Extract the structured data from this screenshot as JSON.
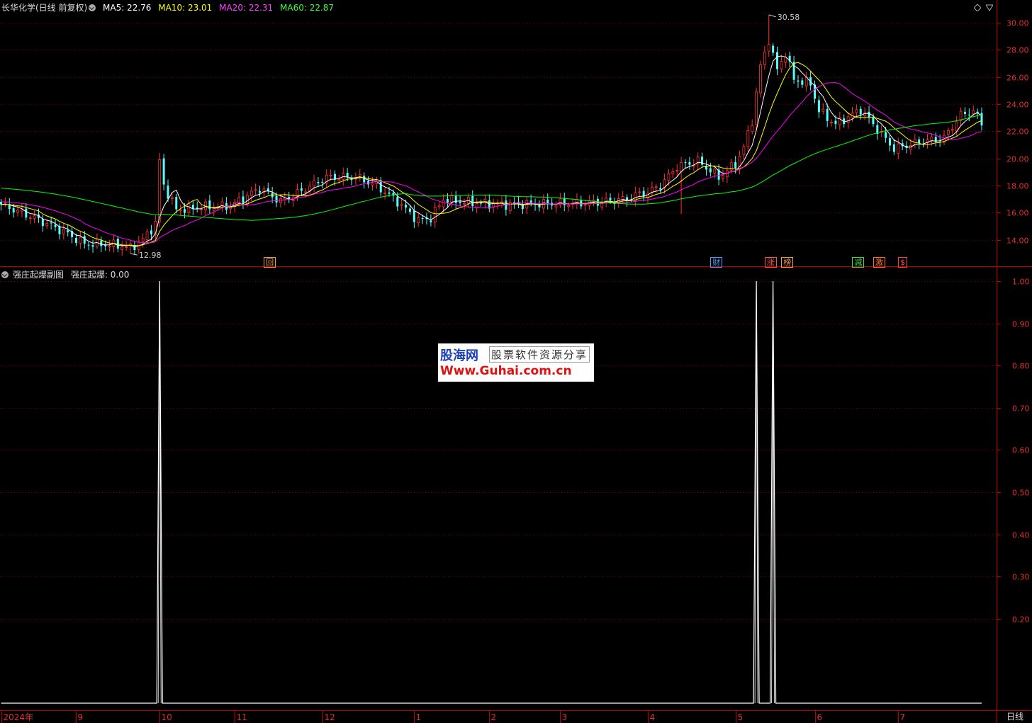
{
  "header": {
    "title": "长华化学(日线 前复权)",
    "ma5_label": "MA5: 22.76",
    "ma10_label": "MA10: 23.01",
    "ma20_label": "MA20: 22.31",
    "ma60_label": "MA60: 22.87"
  },
  "sub_header": {
    "title": "强庄起爆副图",
    "value_label": "强庄起爆: 0.00"
  },
  "badges": [
    {
      "text": "回",
      "color": "#f0a040"
    },
    {
      "text": "财",
      "color": "#4aa0ff"
    },
    {
      "text": "涨",
      "color": "#ff5050"
    },
    {
      "text": "榜",
      "color": "#f0a040"
    },
    {
      "text": "减",
      "color": "#40e040"
    },
    {
      "text": "激",
      "color": "#ff7020"
    },
    {
      "text": "$",
      "color": "#ff4040"
    }
  ],
  "watermark": {
    "top": "股海网",
    "right": "股票软件资源分享",
    "bottom": "Www.Guhai.com.cn"
  },
  "period_label": "日线",
  "colors": {
    "up": "#ff3232",
    "down": "#54ffff",
    "ma5": "#ffffff",
    "ma10": "#ffff00",
    "ma20": "#ff00ff",
    "ma60": "#00ff00",
    "grid": "#8b0000",
    "axis": "#c00000"
  },
  "chart_data": [
    {
      "type": "candlestick",
      "title": "长华化学(日线 前复权)",
      "ylim": [
        13.0,
        31.0
      ],
      "y_ticks": [
        "30.00",
        "28.00",
        "26.00",
        "24.00",
        "22.00",
        "20.00",
        "18.00",
        "16.00",
        "14.00"
      ],
      "x_ticks": [
        "2024年",
        "9",
        "10",
        "11",
        "12",
        "1",
        "2",
        "3",
        "4",
        "5",
        "6",
        "7"
      ],
      "annotations": [
        {
          "text": "30.58",
          "value": 30.58
        },
        {
          "text": "12.98",
          "value": 12.98
        }
      ],
      "close_path": [
        [
          0,
          16.6
        ],
        [
          8,
          15.6
        ],
        [
          15,
          14.6
        ],
        [
          20,
          13.7
        ],
        [
          28,
          13.6
        ],
        [
          31,
          13.4
        ],
        [
          34,
          14.0
        ],
        [
          37,
          15.2
        ],
        [
          38,
          19.8
        ],
        [
          39,
          18.0
        ],
        [
          42,
          16.2
        ],
        [
          48,
          16.4
        ],
        [
          55,
          16.5
        ],
        [
          62,
          17.8
        ],
        [
          67,
          16.8
        ],
        [
          72,
          17.6
        ],
        [
          78,
          18.6
        ],
        [
          85,
          18.6
        ],
        [
          90,
          18.0
        ],
        [
          95,
          16.8
        ],
        [
          100,
          15.4
        ],
        [
          103,
          15.6
        ],
        [
          106,
          17.0
        ],
        [
          110,
          16.8
        ],
        [
          120,
          16.6
        ],
        [
          140,
          16.7
        ],
        [
          150,
          17.0
        ],
        [
          152,
          17.3
        ],
        [
          155,
          17.5
        ],
        [
          158,
          18.0
        ],
        [
          162,
          19.4
        ],
        [
          167,
          19.8
        ],
        [
          172,
          18.6
        ],
        [
          176,
          19.6
        ],
        [
          178,
          20.8
        ],
        [
          180,
          22.8
        ],
        [
          182,
          26.8
        ],
        [
          184,
          28.6
        ],
        [
          186,
          26.5
        ],
        [
          188,
          27.8
        ],
        [
          190,
          25.8
        ],
        [
          194,
          25.5
        ],
        [
          196,
          23.5
        ],
        [
          200,
          22.5
        ],
        [
          206,
          23.6
        ],
        [
          212,
          21.4
        ],
        [
          214,
          20.7
        ],
        [
          220,
          21.2
        ],
        [
          226,
          21.5
        ],
        [
          230,
          23.2
        ],
        [
          233,
          23.5
        ],
        [
          235,
          22.6
        ]
      ],
      "ma_start_values": {
        "ma5": 16.6,
        "ma10": 16.6,
        "ma20": 16.8,
        "ma60": 17.8
      },
      "bar_count": 236
    },
    {
      "type": "line",
      "title": "强庄起爆副图",
      "ylim": [
        0,
        1.05
      ],
      "y_ticks": [
        "1.00",
        "0.90",
        "0.80",
        "0.70",
        "0.60",
        "0.50",
        "0.40",
        "0.30",
        "0.20"
      ],
      "series": [
        {
          "name": "强庄起爆",
          "spikes_at_bar": [
            38,
            181,
            185
          ],
          "baseline": 0,
          "peak": 1.0
        }
      ]
    }
  ]
}
